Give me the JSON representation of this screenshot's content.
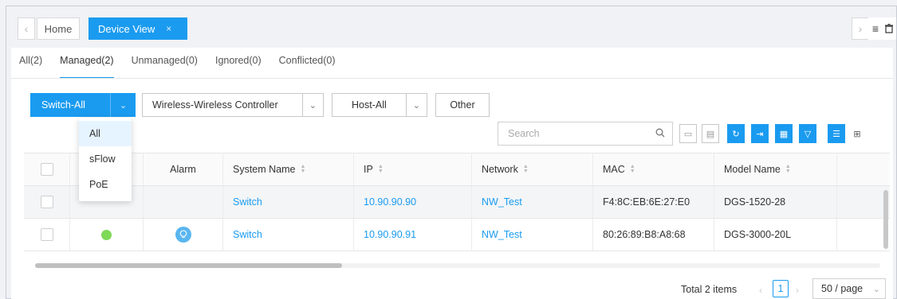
{
  "window_tabs": {
    "prev_icon": "chevron-left-icon",
    "home_label": "Home",
    "active_label": "Device View",
    "active_close": "×",
    "next_icon": "chevron-right-icon"
  },
  "subtabs": [
    {
      "label": "All(2)"
    },
    {
      "label": "Managed(2)"
    },
    {
      "label": "Unmanaged(0)"
    },
    {
      "label": "Ignored(0)"
    },
    {
      "label": "Conflicted(0)"
    }
  ],
  "active_subtab": "Managed(2)",
  "filters": {
    "switch_label": "Switch-All",
    "wireless_label": "Wireless-Wireless Controller",
    "host_label": "Host-All",
    "other_label": "Other"
  },
  "switch_menu": [
    "All",
    "sFlow",
    "PoE"
  ],
  "switch_menu_selected": "All",
  "search": {
    "placeholder": "Search"
  },
  "table": {
    "columns": [
      "",
      "",
      "Alarm",
      "System Name",
      "IP",
      "Network",
      "MAC",
      "Model Name",
      ""
    ],
    "rows": [
      {
        "status": "",
        "alarm": "",
        "system_name": "Switch",
        "ip": "10.90.90.90",
        "network": "NW_Test",
        "mac": "F4:8C:EB:6E:27:E0",
        "model": "DGS-1520-28"
      },
      {
        "status": "green",
        "alarm": "bulb",
        "system_name": "Switch",
        "ip": "10.90.90.91",
        "network": "NW_Test",
        "mac": "80:26:89:B8:A8:68",
        "model": "DGS-3000-20L"
      }
    ]
  },
  "pagination": {
    "total": "Total 2 items",
    "current_page": "1",
    "page_size": "50 / page"
  },
  "colors": {
    "accent": "#1a9bf0",
    "status_ok": "#7ed957"
  }
}
